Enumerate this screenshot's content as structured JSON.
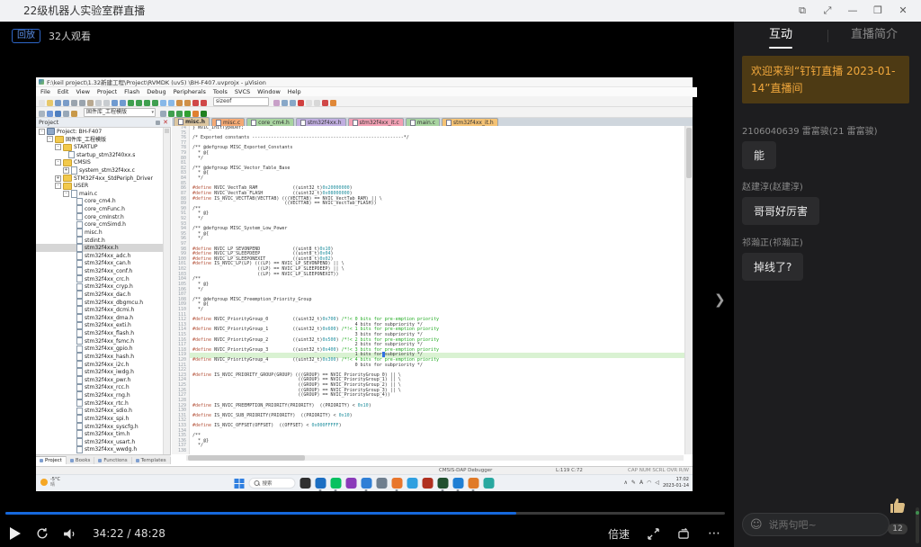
{
  "window": {
    "title": "22级机器人实验室群直播",
    "controls": [
      {
        "name": "screen-cast-icon",
        "glyph": "⧉"
      },
      {
        "name": "resize-icon",
        "glyph": "⤢"
      },
      {
        "name": "minimize-icon",
        "glyph": "—"
      },
      {
        "name": "maximize-icon",
        "glyph": "❐"
      },
      {
        "name": "close-icon",
        "glyph": "✕"
      }
    ]
  },
  "player": {
    "badge": "回放",
    "viewers": "32人观看",
    "time": "34:22 / 48:28",
    "speed_label": "倍速",
    "more_glyph": "⋯",
    "collapse_glyph": "❯",
    "progress": 0.71,
    "accent_color": "#1668dc"
  },
  "chat": {
    "tabs": [
      {
        "label": "互动",
        "active": true
      },
      {
        "label": "直播简介",
        "active": false
      }
    ],
    "welcome": "欢迎来到“钉钉直播 2023-01-14”直播间",
    "messages": [
      {
        "user": "2106040639 雷富骏(21 雷富骏)",
        "text": "能"
      },
      {
        "user": "赵建淳(赵建淳)",
        "text": "哥哥好厉害"
      },
      {
        "user": "祁瀚正(祁瀚正)",
        "text": "掉线了?"
      }
    ],
    "emoji_glyph": "☺",
    "input_placeholder": "说两句吧~",
    "like_count": "12"
  },
  "ide": {
    "window_title": "F:\\keil project\\1.32新建工程\\Project\\RVMDK (uv5) \\BH-F407.uvprojx - µVision",
    "menu": [
      "File",
      "Edit",
      "View",
      "Project",
      "Flash",
      "Debug",
      "Peripherals",
      "Tools",
      "SVCS",
      "Window",
      "Help"
    ],
    "toolbar1_left": [
      [
        "new-file",
        "#e4e4e4"
      ],
      [
        "open-folder",
        "#e8c86a"
      ],
      [
        "save",
        "#7a9cc8"
      ],
      [
        "save-all",
        "#7a9cc8"
      ],
      [
        "cut",
        "#9aa4ae"
      ],
      [
        "copy",
        "#9aa4ae"
      ],
      [
        "paste",
        "#b8a890"
      ],
      [
        "undo",
        "#c8ccd0"
      ],
      [
        "redo",
        "#c8ccd0"
      ],
      [
        "navigate-back",
        "#6f9ad0"
      ],
      [
        "navigate-forward",
        "#6f9ad0"
      ],
      [
        "bookmark",
        "#3f9f4f"
      ],
      [
        "prev-bookmark",
        "#3f9f4f"
      ],
      [
        "next-bookmark",
        "#3f9f4f"
      ],
      [
        "clear-bookmarks",
        "#3f9f4f"
      ],
      [
        "comment",
        "#88b8e8"
      ],
      [
        "uncomment",
        "#88b8e8"
      ],
      [
        "indent",
        "#d09048"
      ],
      [
        "outdent",
        "#d09048"
      ],
      [
        "breakpoint-toggle",
        "#d04848"
      ],
      [
        "breakpoint-clear",
        "#d04848"
      ]
    ],
    "toolbar1_search": "sizeof",
    "toolbar1_right": [
      [
        "find-in-files",
        "#c8a0c8"
      ],
      [
        "find",
        "#88a8c8"
      ],
      [
        "incremental-find",
        "#88a8c8"
      ],
      [
        "start-debug",
        "#d04040"
      ],
      [
        "insert",
        "#e0e0e0"
      ],
      [
        "options-faded",
        "#d8d8d8"
      ],
      [
        "help",
        "#d04848"
      ],
      [
        "pack-installer",
        "#e08838"
      ]
    ],
    "toolbar2_left": [
      [
        "translate",
        "#a8b4c0"
      ],
      [
        "build",
        "#6f98d8"
      ],
      [
        "rebuild",
        "#4f7fc0"
      ],
      [
        "batch-build",
        "#98a8b8"
      ],
      [
        "flash-download",
        "#c89848"
      ]
    ],
    "target_name": "固件库_工程模版",
    "toolbar2_right": [
      [
        "target-options",
        "#98a8b8"
      ],
      [
        "file-extensions",
        "#3f9f4f"
      ],
      [
        "functions-window",
        "#3f9f4f"
      ],
      [
        "templates-window",
        "#30a030"
      ],
      [
        "manage-run-time",
        "#e08030"
      ],
      [
        "books-window",
        "#208020"
      ]
    ],
    "project_panel": {
      "title": "Project",
      "tabs": [
        "Project",
        "Books",
        "Functions",
        "Templates"
      ]
    },
    "tree": [
      {
        "l": "Project: BH-F407",
        "d": 0,
        "i": "chip",
        "e": "-"
      },
      {
        "l": "固件库_工程模版",
        "d": 1,
        "i": "folder",
        "e": "-"
      },
      {
        "l": "STARTUP",
        "d": 2,
        "i": "folder",
        "e": "-"
      },
      {
        "l": "startup_stm32f40xx.s",
        "d": 3,
        "i": "file",
        "e": ""
      },
      {
        "l": "CMSIS",
        "d": 2,
        "i": "folder",
        "e": "-"
      },
      {
        "l": "system_stm32f4xx.c",
        "d": 3,
        "i": "file",
        "e": "+"
      },
      {
        "l": "STM32F4xx_StdPeriph_Driver",
        "d": 2,
        "i": "folder",
        "e": "+"
      },
      {
        "l": "USER",
        "d": 2,
        "i": "folder",
        "e": "-"
      },
      {
        "l": "main.c",
        "d": 3,
        "i": "file",
        "e": "-"
      },
      {
        "l": "core_cm4.h",
        "d": 4,
        "i": "file",
        "e": ""
      },
      {
        "l": "core_cmFunc.h",
        "d": 4,
        "i": "file",
        "e": ""
      },
      {
        "l": "core_cmInstr.h",
        "d": 4,
        "i": "file",
        "e": ""
      },
      {
        "l": "core_cmSimd.h",
        "d": 4,
        "i": "file",
        "e": ""
      },
      {
        "l": "misc.h",
        "d": 4,
        "i": "file",
        "e": ""
      },
      {
        "l": "stdint.h",
        "d": 4,
        "i": "file",
        "e": ""
      },
      {
        "l": "stm32f4xx.h",
        "d": 4,
        "i": "file",
        "e": "",
        "sel": 1
      },
      {
        "l": "stm32f4xx_adc.h",
        "d": 4,
        "i": "file",
        "e": ""
      },
      {
        "l": "stm32f4xx_can.h",
        "d": 4,
        "i": "file",
        "e": ""
      },
      {
        "l": "stm32f4xx_conf.h",
        "d": 4,
        "i": "file",
        "e": ""
      },
      {
        "l": "stm32f4xx_crc.h",
        "d": 4,
        "i": "file",
        "e": ""
      },
      {
        "l": "stm32f4xx_cryp.h",
        "d": 4,
        "i": "file",
        "e": ""
      },
      {
        "l": "stm32f4xx_dac.h",
        "d": 4,
        "i": "file",
        "e": ""
      },
      {
        "l": "stm32f4xx_dbgmcu.h",
        "d": 4,
        "i": "file",
        "e": ""
      },
      {
        "l": "stm32f4xx_dcmi.h",
        "d": 4,
        "i": "file",
        "e": ""
      },
      {
        "l": "stm32f4xx_dma.h",
        "d": 4,
        "i": "file",
        "e": ""
      },
      {
        "l": "stm32f4xx_exti.h",
        "d": 4,
        "i": "file",
        "e": ""
      },
      {
        "l": "stm32f4xx_flash.h",
        "d": 4,
        "i": "file",
        "e": ""
      },
      {
        "l": "stm32f4xx_fsmc.h",
        "d": 4,
        "i": "file",
        "e": ""
      },
      {
        "l": "stm32f4xx_gpio.h",
        "d": 4,
        "i": "file",
        "e": ""
      },
      {
        "l": "stm32f4xx_hash.h",
        "d": 4,
        "i": "file",
        "e": ""
      },
      {
        "l": "stm32f4xx_i2c.h",
        "d": 4,
        "i": "file",
        "e": ""
      },
      {
        "l": "stm32f4xx_iwdg.h",
        "d": 4,
        "i": "file",
        "e": ""
      },
      {
        "l": "stm32f4xx_pwr.h",
        "d": 4,
        "i": "file",
        "e": ""
      },
      {
        "l": "stm32f4xx_rcc.h",
        "d": 4,
        "i": "file",
        "e": ""
      },
      {
        "l": "stm32f4xx_rng.h",
        "d": 4,
        "i": "file",
        "e": ""
      },
      {
        "l": "stm32f4xx_rtc.h",
        "d": 4,
        "i": "file",
        "e": ""
      },
      {
        "l": "stm32f4xx_sdio.h",
        "d": 4,
        "i": "file",
        "e": ""
      },
      {
        "l": "stm32f4xx_spi.h",
        "d": 4,
        "i": "file",
        "e": ""
      },
      {
        "l": "stm32f4xx_syscfg.h",
        "d": 4,
        "i": "file",
        "e": ""
      },
      {
        "l": "stm32f4xx_tim.h",
        "d": 4,
        "i": "file",
        "e": ""
      },
      {
        "l": "stm32f4xx_usart.h",
        "d": 4,
        "i": "file",
        "e": ""
      },
      {
        "l": "stm32f4xx_wwdg.h",
        "d": 4,
        "i": "file",
        "e": ""
      }
    ],
    "editor_tabs": [
      {
        "label": "misc.h",
        "color": "#dcc6a0",
        "active": true
      },
      {
        "label": "misc.c",
        "color": "#f4a974"
      },
      {
        "label": "core_cm4.h",
        "color": "#a8d4a0"
      },
      {
        "label": "stm32f4xx.h",
        "color": "#c0aee0"
      },
      {
        "label": "stm32f4xx_it.c",
        "color": "#f2a0b4"
      },
      {
        "label": "main.c",
        "color": "#a8d4a0"
      },
      {
        "label": "stm32f4xx_it.h",
        "color": "#f4c274"
      }
    ],
    "code": [
      {
        "n": 74,
        "t": "p",
        "s": "} NVIC_InitTypeDef;"
      },
      {
        "n": 75,
        "t": "p",
        "s": ""
      },
      {
        "n": 76,
        "t": "c",
        "s": "/* Exported constants --------------------------------------------------------*/"
      },
      {
        "n": 77,
        "t": "p",
        "s": ""
      },
      {
        "n": 78,
        "t": "c",
        "s": "/** @defgroup MISC_Exported_Constants"
      },
      {
        "n": 79,
        "t": "c",
        "s": "  * @{"
      },
      {
        "n": 80,
        "t": "c",
        "s": "  */"
      },
      {
        "n": 81,
        "t": "p",
        "s": ""
      },
      {
        "n": 82,
        "t": "c",
        "s": "/** @defgroup MISC_Vector_Table_Base"
      },
      {
        "n": 83,
        "t": "c",
        "s": "  * @{"
      },
      {
        "n": 84,
        "t": "c",
        "s": "  */"
      },
      {
        "n": 85,
        "t": "p",
        "s": ""
      },
      {
        "n": 86,
        "t": "d",
        "s": "#define NVIC_VectTab_RAM             ((uint32_t)0x20000000)"
      },
      {
        "n": 87,
        "t": "d",
        "s": "#define NVIC_VectTab_FLASH           ((uint32_t)0x08000000)"
      },
      {
        "n": 88,
        "t": "d",
        "s": "#define IS_NVIC_VECTTAB(VECTTAB) (((VECTTAB) == NVIC_VectTab_RAM) || \\"
      },
      {
        "n": 89,
        "t": "p",
        "s": "                                  ((VECTTAB) == NVIC_VectTab_FLASH))"
      },
      {
        "n": 90,
        "t": "c",
        "s": "/**"
      },
      {
        "n": 91,
        "t": "c",
        "s": "  * @}"
      },
      {
        "n": 92,
        "t": "c",
        "s": "  */"
      },
      {
        "n": 93,
        "t": "p",
        "s": ""
      },
      {
        "n": 94,
        "t": "c",
        "s": "/** @defgroup MISC_System_Low_Power"
      },
      {
        "n": 95,
        "t": "c",
        "s": "  * @{"
      },
      {
        "n": 96,
        "t": "c",
        "s": "  */"
      },
      {
        "n": 97,
        "t": "p",
        "s": ""
      },
      {
        "n": 98,
        "t": "d",
        "s": "#define NVIC_LP_SEVONPEND            ((uint8_t)0x10)"
      },
      {
        "n": 99,
        "t": "d",
        "s": "#define NVIC_LP_SLEEPDEEP            ((uint8_t)0x04)"
      },
      {
        "n": 100,
        "t": "d",
        "s": "#define NVIC_LP_SLEEPONEXIT          ((uint8_t)0x02)"
      },
      {
        "n": 101,
        "t": "d",
        "s": "#define IS_NVIC_LP(LP) (((LP) == NVIC_LP_SEVONPEND) || \\"
      },
      {
        "n": 102,
        "t": "p",
        "s": "                        ((LP) == NVIC_LP_SLEEPDEEP) || \\"
      },
      {
        "n": 103,
        "t": "p",
        "s": "                        ((LP) == NVIC_LP_SLEEPONEXIT))"
      },
      {
        "n": 104,
        "t": "c",
        "s": "/**"
      },
      {
        "n": 105,
        "t": "c",
        "s": "  * @}"
      },
      {
        "n": 106,
        "t": "c",
        "s": "  */"
      },
      {
        "n": 107,
        "t": "p",
        "s": ""
      },
      {
        "n": 108,
        "t": "c",
        "s": "/** @defgroup MISC_Preemption_Priority_Group"
      },
      {
        "n": 109,
        "t": "c",
        "s": "  * @{"
      },
      {
        "n": 110,
        "t": "c",
        "s": "  */"
      },
      {
        "n": 111,
        "t": "p",
        "s": ""
      },
      {
        "n": 112,
        "t": "d",
        "s": "#define NVIC_PriorityGroup_0         ((uint32_t)0x700) /*!< 0 bits for pre-emption priority"
      },
      {
        "n": 113,
        "t": "x",
        "s": "                                                            4 bits for subpriority */"
      },
      {
        "n": 114,
        "t": "d",
        "s": "#define NVIC_PriorityGroup_1         ((uint32_t)0x600) /*!< 1 bits for pre-emption priority"
      },
      {
        "n": 115,
        "t": "x",
        "s": "                                                            3 bits for subpriority */"
      },
      {
        "n": 116,
        "t": "d",
        "s": "#define NVIC_PriorityGroup_2         ((uint32_t)0x500) /*!< 2 bits for pre-emption priority"
      },
      {
        "n": 117,
        "t": "x",
        "s": "                                                            2 bits for subpriority */"
      },
      {
        "n": 118,
        "t": "d",
        "s": "#define NVIC_PriorityGroup_3         ((uint32_t)0x400) /*!< 3 bits for pre-emption priority"
      },
      {
        "n": 119,
        "t": "x",
        "s": "                                                            1 bits for subpriority */",
        "hl": 1,
        "cur": 1
      },
      {
        "n": 120,
        "t": "d",
        "s": "#define NVIC_PriorityGroup_4         ((uint32_t)0x300) /*!< 4 bits for pre-emption priority"
      },
      {
        "n": 121,
        "t": "x",
        "s": "                                                            0 bits for subpriority */"
      },
      {
        "n": 122,
        "t": "p",
        "s": ""
      },
      {
        "n": 123,
        "t": "d",
        "s": "#define IS_NVIC_PRIORITY_GROUP(GROUP) (((GROUP) == NVIC_PriorityGroup_0) || \\"
      },
      {
        "n": 124,
        "t": "p",
        "s": "                                       ((GROUP) == NVIC_PriorityGroup_1) || \\"
      },
      {
        "n": 125,
        "t": "p",
        "s": "                                       ((GROUP) == NVIC_PriorityGroup_2) || \\"
      },
      {
        "n": 126,
        "t": "p",
        "s": "                                       ((GROUP) == NVIC_PriorityGroup_3) || \\"
      },
      {
        "n": 127,
        "t": "p",
        "s": "                                       ((GROUP) == NVIC_PriorityGroup_4))"
      },
      {
        "n": 128,
        "t": "p",
        "s": ""
      },
      {
        "n": 129,
        "t": "d",
        "s": "#define IS_NVIC_PREEMPTION_PRIORITY(PRIORITY)  ((PRIORITY) < 0x10)"
      },
      {
        "n": 130,
        "t": "p",
        "s": ""
      },
      {
        "n": 131,
        "t": "d",
        "s": "#define IS_NVIC_SUB_PRIORITY(PRIORITY)  ((PRIORITY) < 0x10)"
      },
      {
        "n": 132,
        "t": "p",
        "s": ""
      },
      {
        "n": 133,
        "t": "d",
        "s": "#define IS_NVIC_OFFSET(OFFSET)  ((OFFSET) < 0x000FFFFF)"
      },
      {
        "n": 134,
        "t": "p",
        "s": ""
      },
      {
        "n": 135,
        "t": "c",
        "s": "/**"
      },
      {
        "n": 136,
        "t": "c",
        "s": "  * @}"
      },
      {
        "n": 137,
        "t": "c",
        "s": "  */"
      },
      {
        "n": 138,
        "t": "p",
        "s": ""
      }
    ],
    "status": {
      "debugger": "CMSIS-DAP Debugger",
      "position": "L:119 C:72",
      "flags": "CAP NUM SCRL OVR R/W"
    }
  },
  "taskbar": {
    "weather_temp": "-5°C",
    "weather_desc": "晴",
    "search_label": "搜索",
    "apps": [
      {
        "name": "notes-app-icon",
        "c": "#2f2f2f"
      },
      {
        "name": "edge-browser-icon",
        "c": "#1b6ec2",
        "dot": 1
      },
      {
        "name": "wechat-icon",
        "c": "#07c160",
        "dot": 1
      },
      {
        "name": "media-player-icon",
        "c": "#8a3ab9"
      },
      {
        "name": "browser-icon",
        "c": "#2f7fd6",
        "dot": 1
      },
      {
        "name": "settings-icon",
        "c": "#6f7f8f"
      },
      {
        "name": "office-app-icon",
        "c": "#e8762c",
        "dot": 1
      },
      {
        "name": "drive-app-icon",
        "c": "#2f9fe0"
      },
      {
        "name": "matlab-icon",
        "c": "#b03020"
      },
      {
        "name": "keil-icon",
        "c": "#20502f",
        "dot": 1
      },
      {
        "name": "vscode-icon",
        "c": "#1f7fd4",
        "dot": 1
      },
      {
        "name": "ftp-app-icon",
        "c": "#e07a28",
        "dot": 1
      },
      {
        "name": "chat-app-icon",
        "c": "#28a8a0"
      }
    ],
    "tray_glyphs": [
      {
        "name": "tray-chevron-icon",
        "g": "∧"
      },
      {
        "name": "pen-icon",
        "g": "✎"
      },
      {
        "name": "input-method-icon",
        "g": "A"
      },
      {
        "name": "network-icon",
        "g": "◠"
      },
      {
        "name": "volume-tray-icon",
        "g": "◁"
      }
    ],
    "time": "17:02",
    "date": "2023-01-14"
  }
}
